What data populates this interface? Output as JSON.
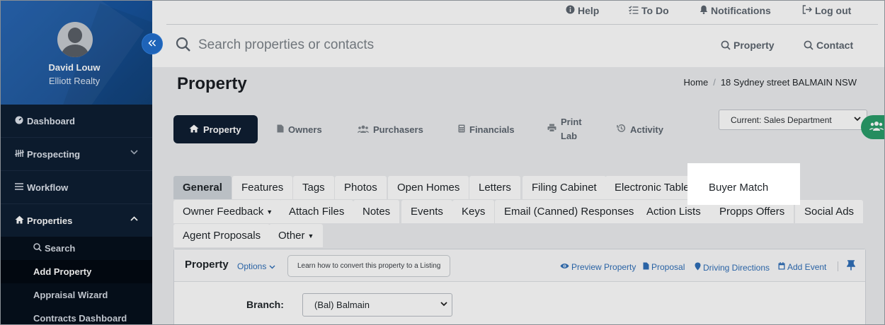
{
  "user": {
    "name": "David Louw",
    "company": "Elliott Realty"
  },
  "sidebar": {
    "items": [
      {
        "label": "Dashboard",
        "icon": "dashboard-icon"
      },
      {
        "label": "Prospecting",
        "icon": "tally-icon"
      },
      {
        "label": "Workflow",
        "icon": "menu-icon"
      },
      {
        "label": "Properties",
        "icon": "home-icon"
      }
    ],
    "properties_sub": [
      {
        "label": "Search"
      },
      {
        "label": "Add Property"
      },
      {
        "label": "Appraisal Wizard"
      },
      {
        "label": "Contracts Dashboard"
      }
    ]
  },
  "topbar": {
    "help": "Help",
    "todo": "To Do",
    "notifications": "Notifications",
    "logout": "Log out"
  },
  "search": {
    "placeholder": "Search properties or contacts",
    "scope_property": "Property",
    "scope_contact": "Contact"
  },
  "page": {
    "title": "Property",
    "breadcrumb_home": "Home",
    "breadcrumb_current": "18 Sydney street BALMAIN NSW"
  },
  "tabs": {
    "property": "Property",
    "owners": "Owners",
    "purchasers": "Purchasers",
    "financials": "Financials",
    "print_line1": "Print",
    "print_line2": "Lab",
    "activity": "Activity"
  },
  "department": {
    "selected": "Current: Sales Department"
  },
  "subtabs": {
    "row1": [
      "General",
      "Features",
      "Tags",
      "Photos",
      "Open Homes",
      "Letters",
      "Filing Cabinet",
      "Electronic Table",
      "Buyer Match"
    ],
    "row2": [
      "Owner Feedback",
      "Attach Files",
      "Notes",
      "Events",
      "Keys",
      "Email (Canned) Responses",
      "Action Lists",
      "Propps Offers",
      "Social Ads"
    ],
    "row3": [
      "Agent Proposals",
      "Other"
    ]
  },
  "panel": {
    "title": "Property",
    "options": "Options",
    "learn": "Learn how to convert this property to a Listing",
    "preview": "Preview Property",
    "proposal": "Proposal",
    "directions": "Driving Directions",
    "add_event": "Add Event"
  },
  "form": {
    "branch_label": "Branch:",
    "branch_value": "(Bal) Balmain"
  },
  "colors": {
    "sidebar": "#0e1f33",
    "profile": "#17539c",
    "accent_link": "#2f6fb8",
    "active_tab": "#0f1f33",
    "group_button": "#2a9d6a"
  }
}
